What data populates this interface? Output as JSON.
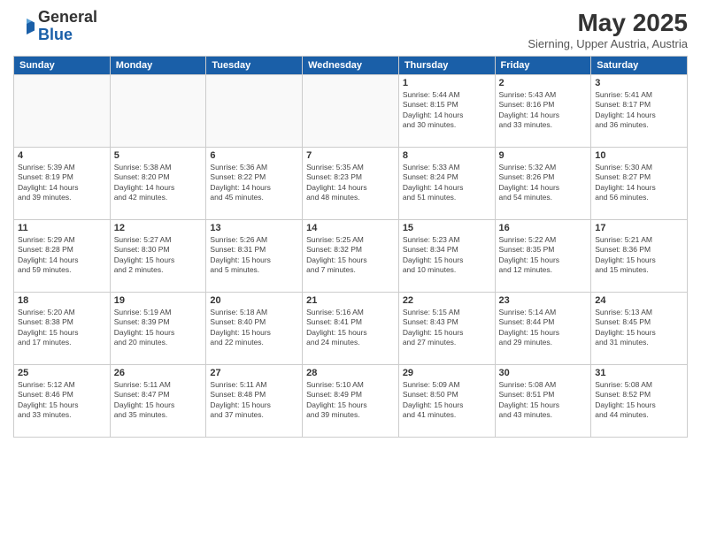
{
  "logo": {
    "general": "General",
    "blue": "Blue"
  },
  "title": "May 2025",
  "subtitle": "Sierning, Upper Austria, Austria",
  "weekdays": [
    "Sunday",
    "Monday",
    "Tuesday",
    "Wednesday",
    "Thursday",
    "Friday",
    "Saturday"
  ],
  "weeks": [
    [
      {
        "day": "",
        "info": ""
      },
      {
        "day": "",
        "info": ""
      },
      {
        "day": "",
        "info": ""
      },
      {
        "day": "",
        "info": ""
      },
      {
        "day": "1",
        "info": "Sunrise: 5:44 AM\nSunset: 8:15 PM\nDaylight: 14 hours\nand 30 minutes."
      },
      {
        "day": "2",
        "info": "Sunrise: 5:43 AM\nSunset: 8:16 PM\nDaylight: 14 hours\nand 33 minutes."
      },
      {
        "day": "3",
        "info": "Sunrise: 5:41 AM\nSunset: 8:17 PM\nDaylight: 14 hours\nand 36 minutes."
      }
    ],
    [
      {
        "day": "4",
        "info": "Sunrise: 5:39 AM\nSunset: 8:19 PM\nDaylight: 14 hours\nand 39 minutes."
      },
      {
        "day": "5",
        "info": "Sunrise: 5:38 AM\nSunset: 8:20 PM\nDaylight: 14 hours\nand 42 minutes."
      },
      {
        "day": "6",
        "info": "Sunrise: 5:36 AM\nSunset: 8:22 PM\nDaylight: 14 hours\nand 45 minutes."
      },
      {
        "day": "7",
        "info": "Sunrise: 5:35 AM\nSunset: 8:23 PM\nDaylight: 14 hours\nand 48 minutes."
      },
      {
        "day": "8",
        "info": "Sunrise: 5:33 AM\nSunset: 8:24 PM\nDaylight: 14 hours\nand 51 minutes."
      },
      {
        "day": "9",
        "info": "Sunrise: 5:32 AM\nSunset: 8:26 PM\nDaylight: 14 hours\nand 54 minutes."
      },
      {
        "day": "10",
        "info": "Sunrise: 5:30 AM\nSunset: 8:27 PM\nDaylight: 14 hours\nand 56 minutes."
      }
    ],
    [
      {
        "day": "11",
        "info": "Sunrise: 5:29 AM\nSunset: 8:28 PM\nDaylight: 14 hours\nand 59 minutes."
      },
      {
        "day": "12",
        "info": "Sunrise: 5:27 AM\nSunset: 8:30 PM\nDaylight: 15 hours\nand 2 minutes."
      },
      {
        "day": "13",
        "info": "Sunrise: 5:26 AM\nSunset: 8:31 PM\nDaylight: 15 hours\nand 5 minutes."
      },
      {
        "day": "14",
        "info": "Sunrise: 5:25 AM\nSunset: 8:32 PM\nDaylight: 15 hours\nand 7 minutes."
      },
      {
        "day": "15",
        "info": "Sunrise: 5:23 AM\nSunset: 8:34 PM\nDaylight: 15 hours\nand 10 minutes."
      },
      {
        "day": "16",
        "info": "Sunrise: 5:22 AM\nSunset: 8:35 PM\nDaylight: 15 hours\nand 12 minutes."
      },
      {
        "day": "17",
        "info": "Sunrise: 5:21 AM\nSunset: 8:36 PM\nDaylight: 15 hours\nand 15 minutes."
      }
    ],
    [
      {
        "day": "18",
        "info": "Sunrise: 5:20 AM\nSunset: 8:38 PM\nDaylight: 15 hours\nand 17 minutes."
      },
      {
        "day": "19",
        "info": "Sunrise: 5:19 AM\nSunset: 8:39 PM\nDaylight: 15 hours\nand 20 minutes."
      },
      {
        "day": "20",
        "info": "Sunrise: 5:18 AM\nSunset: 8:40 PM\nDaylight: 15 hours\nand 22 minutes."
      },
      {
        "day": "21",
        "info": "Sunrise: 5:16 AM\nSunset: 8:41 PM\nDaylight: 15 hours\nand 24 minutes."
      },
      {
        "day": "22",
        "info": "Sunrise: 5:15 AM\nSunset: 8:43 PM\nDaylight: 15 hours\nand 27 minutes."
      },
      {
        "day": "23",
        "info": "Sunrise: 5:14 AM\nSunset: 8:44 PM\nDaylight: 15 hours\nand 29 minutes."
      },
      {
        "day": "24",
        "info": "Sunrise: 5:13 AM\nSunset: 8:45 PM\nDaylight: 15 hours\nand 31 minutes."
      }
    ],
    [
      {
        "day": "25",
        "info": "Sunrise: 5:12 AM\nSunset: 8:46 PM\nDaylight: 15 hours\nand 33 minutes."
      },
      {
        "day": "26",
        "info": "Sunrise: 5:11 AM\nSunset: 8:47 PM\nDaylight: 15 hours\nand 35 minutes."
      },
      {
        "day": "27",
        "info": "Sunrise: 5:11 AM\nSunset: 8:48 PM\nDaylight: 15 hours\nand 37 minutes."
      },
      {
        "day": "28",
        "info": "Sunrise: 5:10 AM\nSunset: 8:49 PM\nDaylight: 15 hours\nand 39 minutes."
      },
      {
        "day": "29",
        "info": "Sunrise: 5:09 AM\nSunset: 8:50 PM\nDaylight: 15 hours\nand 41 minutes."
      },
      {
        "day": "30",
        "info": "Sunrise: 5:08 AM\nSunset: 8:51 PM\nDaylight: 15 hours\nand 43 minutes."
      },
      {
        "day": "31",
        "info": "Sunrise: 5:08 AM\nSunset: 8:52 PM\nDaylight: 15 hours\nand 44 minutes."
      }
    ]
  ]
}
